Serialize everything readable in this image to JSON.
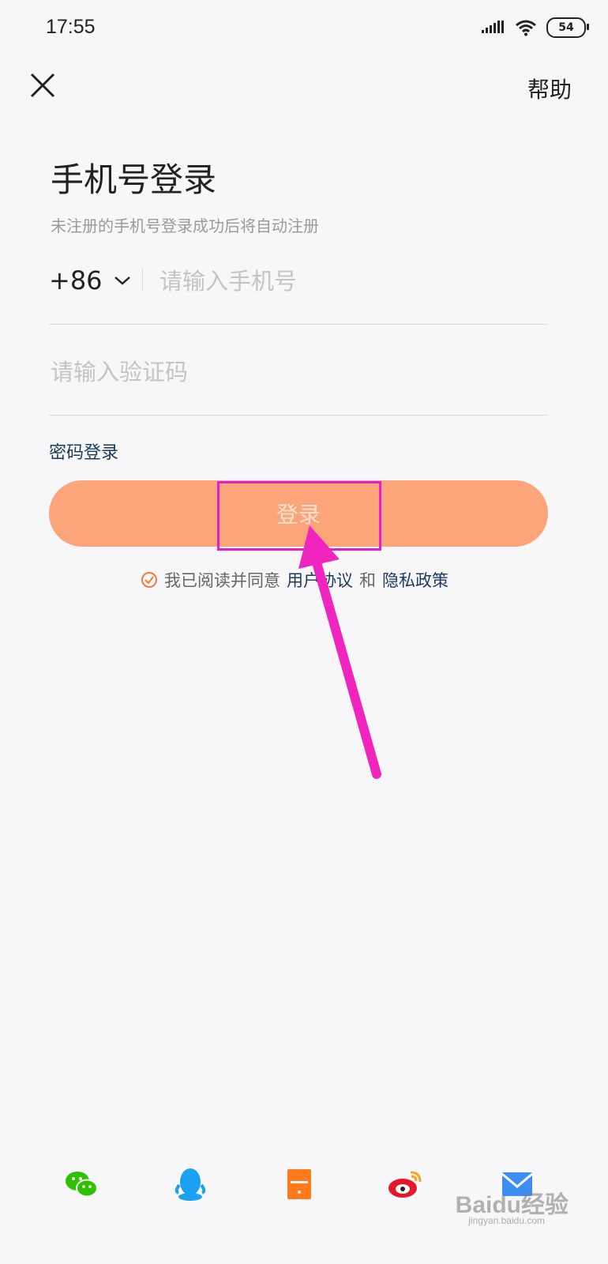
{
  "status_bar": {
    "time": "17:55",
    "battery": "54"
  },
  "header": {
    "help": "帮助"
  },
  "title": "手机号登录",
  "subtitle": "未注册的手机号登录成功后将自动注册",
  "phone": {
    "country_code": "+86",
    "placeholder": "请输入手机号"
  },
  "code": {
    "placeholder": "请输入验证码"
  },
  "password_login": "密码登录",
  "login_button": "登录",
  "agreement": {
    "prefix": "我已阅读并同意",
    "user_agreement": "用户协议",
    "and": "和",
    "privacy_policy": "隐私政策"
  },
  "social": [
    "wechat-icon",
    "qq-icon",
    "phone-login-icon",
    "weibo-icon",
    "email-icon"
  ],
  "watermark": {
    "brand": "Baidu经验",
    "url": "jingyan.baidu.com"
  },
  "colors": {
    "accent": "#fca57b",
    "link": "#1b3a5c",
    "annotation": "#f025c0"
  }
}
